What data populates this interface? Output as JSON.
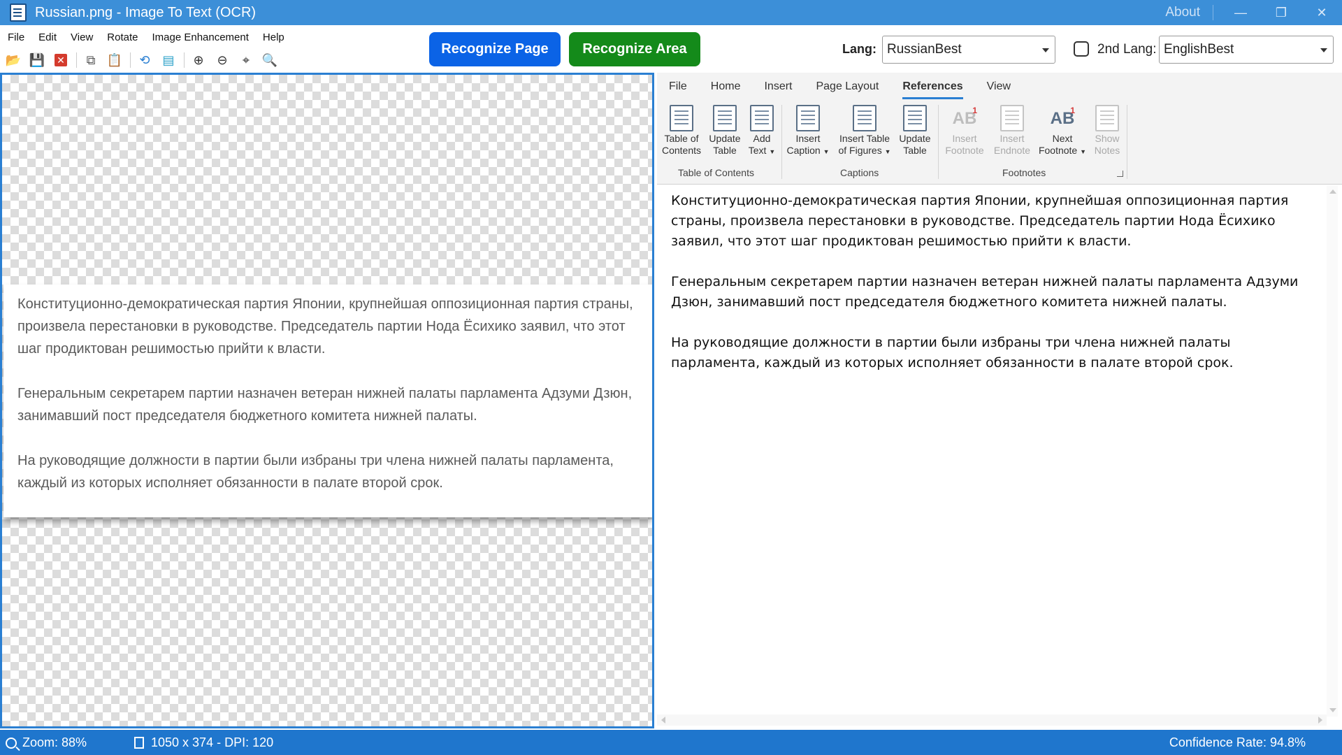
{
  "window": {
    "title": "Russian.png - Image To Text (OCR)",
    "about": "About",
    "minimize_icon": "minimize-icon",
    "maximize_icon": "restore-icon",
    "close_icon": "close-icon"
  },
  "menu": [
    "File",
    "Edit",
    "View",
    "Rotate",
    "Image Enhancement",
    "Help"
  ],
  "toolbar_icons": [
    "open-folder-icon",
    "save-icon",
    "close-file-icon",
    "copy-icon",
    "paste-icon",
    "rotate-icon",
    "ocr-text-icon",
    "zoom-in-icon",
    "zoom-out-icon",
    "zoom-fit-icon",
    "zoom-100-icon"
  ],
  "actions": {
    "recognize_page": "Recognize Page",
    "recognize_area": "Recognize Area"
  },
  "lang": {
    "label": "Lang:",
    "value": "RussianBest",
    "second_label": "2nd Lang:",
    "second_value": "EnglishBest",
    "second_checked": false
  },
  "image": {
    "paragraphs": [
      "Конституционно-демократическая партия Японии, крупнейшая оппозиционная партия страны, произвела перестановки в руководстве. Председатель партии Нода Ёсихико заявил, что этот шаг продиктован решимостью прийти к власти.",
      "Генеральным секретарем партии назначен ветеран нижней палаты парламента Адзуми Дзюн, занимавший пост председателя бюджетного комитета нижней палаты.",
      "На руководящие должности в партии были избраны три члена нижней палаты парламента, каждый из которых исполняет обязанности в палате второй срок."
    ]
  },
  "ribbon": {
    "tabs": [
      "File",
      "Home",
      "Insert",
      "Page Layout",
      "References",
      "View"
    ],
    "active_tab": "References",
    "groups": {
      "toc": "Table of Contents",
      "captions": "Captions",
      "footnotes": "Footnotes"
    },
    "buttons": {
      "table_of_contents": [
        "Table of",
        "Contents"
      ],
      "update_table_1": [
        "Update",
        "Table"
      ],
      "add_text": [
        "Add",
        "Text"
      ],
      "insert_caption": [
        "Insert",
        "Caption"
      ],
      "insert_table_of_figures": [
        "Insert Table",
        "of Figures"
      ],
      "update_table_2": [
        "Update",
        "Table"
      ],
      "insert_footnote": [
        "Insert",
        "Footnote"
      ],
      "insert_endnote": [
        "Insert",
        "Endnote"
      ],
      "next_footnote": [
        "Next",
        "Footnote"
      ],
      "show_notes": [
        "Show",
        "Notes"
      ]
    }
  },
  "editor": {
    "paragraphs": [
      "Конституционно-демократическая партия Японии, крупнейшая оппозиционная партия страны, произвела перестановки в руководстве. Председатель партии Нода Ёсихико заявил, что этот шаг продиктован решимостью прийти к власти.",
      "Генеральным секретарем партии назначен ветеран нижней палаты парламента Адзуми Дзюн, занимавший пост председателя бюджетного комитета нижней палаты.",
      "На руководящие должности в партии были избраны три члена нижней палаты парламента, каждый из которых исполняет обязанности в палате второй срок."
    ]
  },
  "status": {
    "zoom": "Zoom: 88%",
    "size": "1050 x 374 - DPI: 120",
    "confidence": "Confidence Rate: 94.8%"
  },
  "colors": {
    "titlebar": "#3c8fd8",
    "recognize_page": "#0b63e6",
    "recognize_area": "#148a1a",
    "statusbar": "#1f76cd",
    "accent": "#2a7fd2"
  }
}
